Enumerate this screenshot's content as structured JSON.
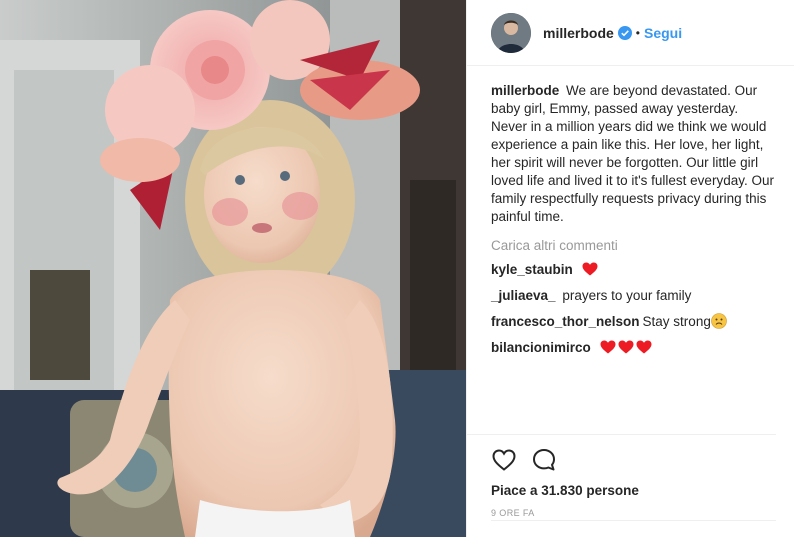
{
  "header": {
    "username": "millerbode",
    "separator": "•",
    "follow_label": "Segui"
  },
  "caption": {
    "username": "millerbode",
    "text": "We are beyond devastated. Our baby girl, Emmy, passed away yesterday. Never in a million years did we think we would experience a pain like this. Her love, her light, her spirit will never be forgotten. Our little girl loved life and lived it to it's fullest everyday. Our family respectfully requests privacy during this painful time."
  },
  "load_more_label": "Carica altri commenti",
  "comments": [
    {
      "username": "kyle_staubin",
      "text": "",
      "emoji": [
        "red-heart"
      ]
    },
    {
      "username": "_juliaeva_",
      "text": "prayers to your family",
      "emoji": []
    },
    {
      "username": "francesco_thor_nelson",
      "text": "Stay strong",
      "emoji": [
        "sad-face"
      ]
    },
    {
      "username": "bilancionimirco",
      "text": "",
      "emoji": [
        "red-heart",
        "red-heart",
        "red-heart"
      ]
    }
  ],
  "likes_label": "Piace a 31.830 persone",
  "timestamp": "9 ORE FA",
  "icons": [
    "heart-outline",
    "comment-bubble",
    "verified-badge"
  ],
  "colors": {
    "link_blue": "#3897f0",
    "verified_blue": "#3897f0",
    "heart_red": "#ed1c24",
    "muted_text": "#999999"
  }
}
